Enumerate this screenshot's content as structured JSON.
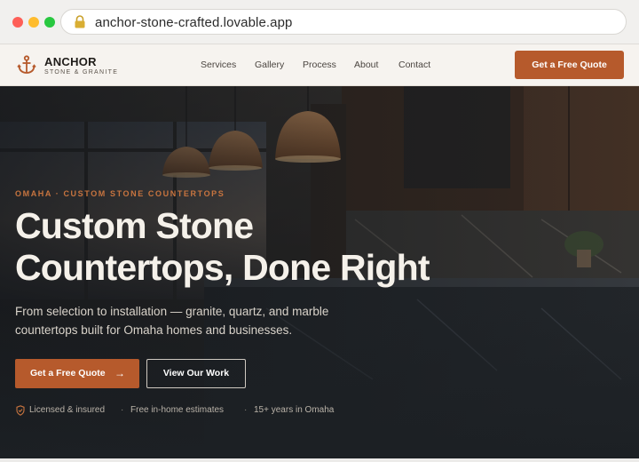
{
  "browser": {
    "url": "anchor-stone-crafted.lovable.app",
    "icons": [
      "close-dot",
      "minimize-dot",
      "maximize-dot",
      "lock-icon"
    ]
  },
  "header": {
    "logo_name": "ANCHOR",
    "logo_sub": "STONE & GRANITE",
    "nav": [
      "Services",
      "Gallery",
      "Process",
      "About",
      "Contact"
    ],
    "cta": "Get a Free Quote"
  },
  "hero": {
    "eyebrow": "OMAHA · CUSTOM STONE COUNTERTOPS",
    "headline_line1": "Custom Stone",
    "headline_line2": "Countertops, Done Right",
    "subtext": "From selection to installation — granite, quartz, and marble countertops built for Omaha homes and businesses.",
    "primary_button": "Get a Free Quote",
    "primary_arrow": "→",
    "secondary_button": "View Our Work",
    "trust": [
      "Licensed & insured",
      "Free in-home estimates",
      "15+ years in Omaha"
    ],
    "separator": "·"
  },
  "colors": {
    "accent": "#b65a2c",
    "eyebrow": "#c7743f",
    "header_bg": "#f6f3ef",
    "headline": "#f5f1ea"
  }
}
